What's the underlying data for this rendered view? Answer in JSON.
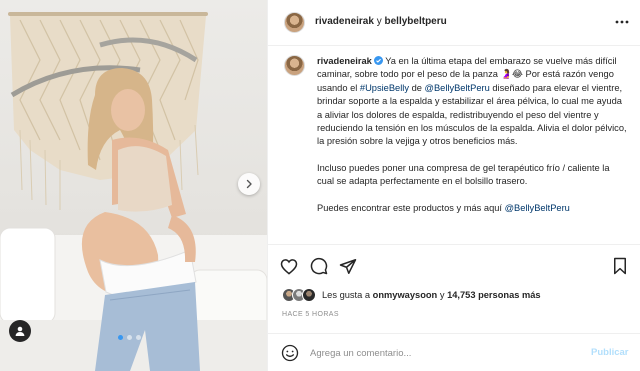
{
  "header": {
    "username": "rivadeneirak",
    "separator": "y",
    "collaborator": "bellybeltperu",
    "more_icon": "ellipsis-icon"
  },
  "caption": {
    "username": "rivadeneirak",
    "verified_icon": "verified-badge-icon",
    "p1_a": "Ya en la última etapa del embarazo se vuelve más difícil caminar, sobre todo por el peso de la panza 🤰😂 Por está razón vengo usando el ",
    "p1_tag1": "#UpsieBelly",
    "p1_b": " de ",
    "p1_tag2": "@BellyBeltPeru",
    "p1_c": " diseñado para elevar el vientre, brindar soporte a la espalda y estabilizar el área pélvica, lo cual me ayuda a aliviar los dolores de espalda, redistribuyendo el peso del vientre y reduciendo la tensión en los músculos de la espalda. Alivia el dolor pélvico, la presión sobre la vejiga y otros beneficios más.",
    "p2": "Incluso puedes poner una compresa de gel terapéutico frío / caliente la cual se adapta perfectamente en el bolsillo trasero.",
    "p3_a": "Puedes encontrar este productos y más aquí ",
    "p3_tag": "@BellyBeltPeru"
  },
  "actions": {
    "like_icon": "heart-icon",
    "comment_icon": "comment-bubble-icon",
    "share_icon": "paper-plane-icon",
    "save_icon": "bookmark-icon"
  },
  "likes": {
    "prefix": "Les gusta a ",
    "user": "onmywaysoon",
    "middle": " y ",
    "count": "14,753 personas más"
  },
  "timestamp": "HACE 5 HORAS",
  "comment": {
    "placeholder": "Agrega un comentario...",
    "publish_label": "Publicar",
    "emoji_icon": "smiley-face-icon"
  },
  "carousel": {
    "slide_count": 3,
    "current_slide": 1,
    "next_icon": "chevron-right-icon",
    "tag_icon": "user-tag-icon"
  },
  "colors": {
    "link": "#00376b",
    "verified": "#3897f0",
    "publish_disabled": "#b2dffc",
    "muted": "#8e8e8e"
  }
}
